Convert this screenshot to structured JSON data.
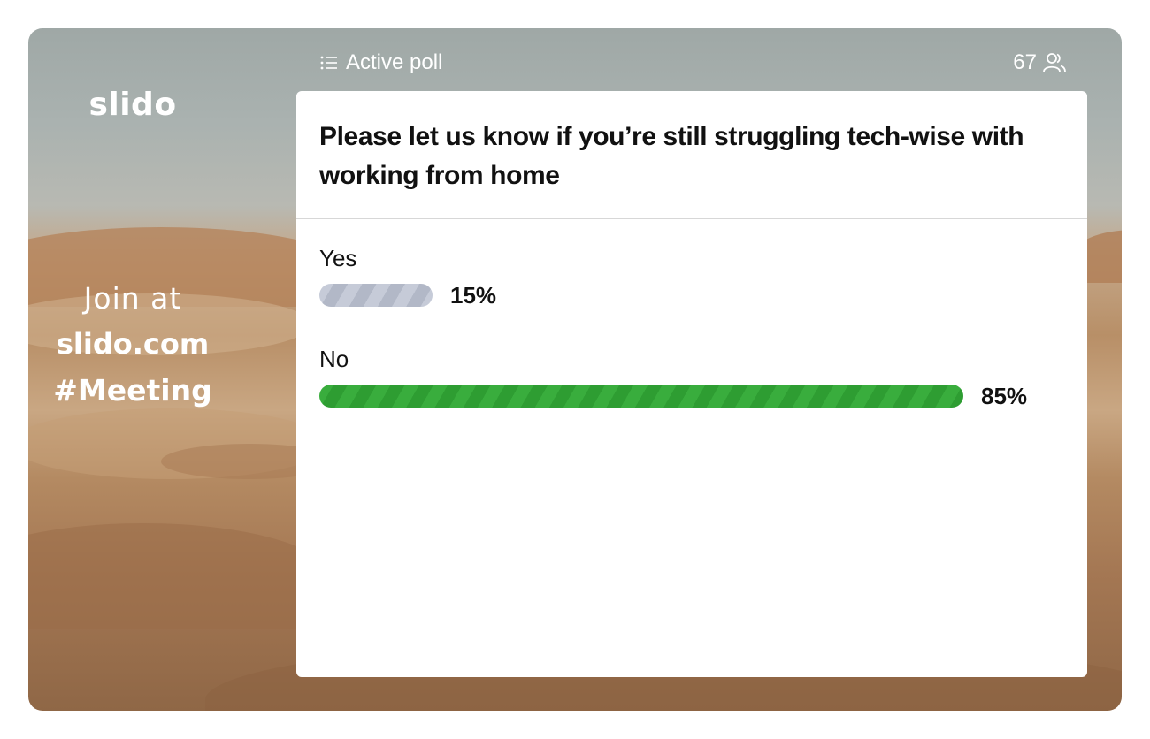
{
  "branding": {
    "logo_text": "slido"
  },
  "join": {
    "prefix": "Join at",
    "url": "slido.com",
    "code": "#Meeting"
  },
  "poll": {
    "status_label": "Active poll",
    "status_icon": "list-icon",
    "participant_count": "67",
    "participant_icon": "people-icon",
    "question": "Please let us know if you’re still struggling tech-wise with working from home",
    "options": [
      {
        "label": "Yes",
        "percent_label": "15%",
        "percent": 15,
        "color": "#b8bdcb"
      },
      {
        "label": "No",
        "percent_label": "85%",
        "percent": 85,
        "color": "#35a838"
      }
    ]
  }
}
